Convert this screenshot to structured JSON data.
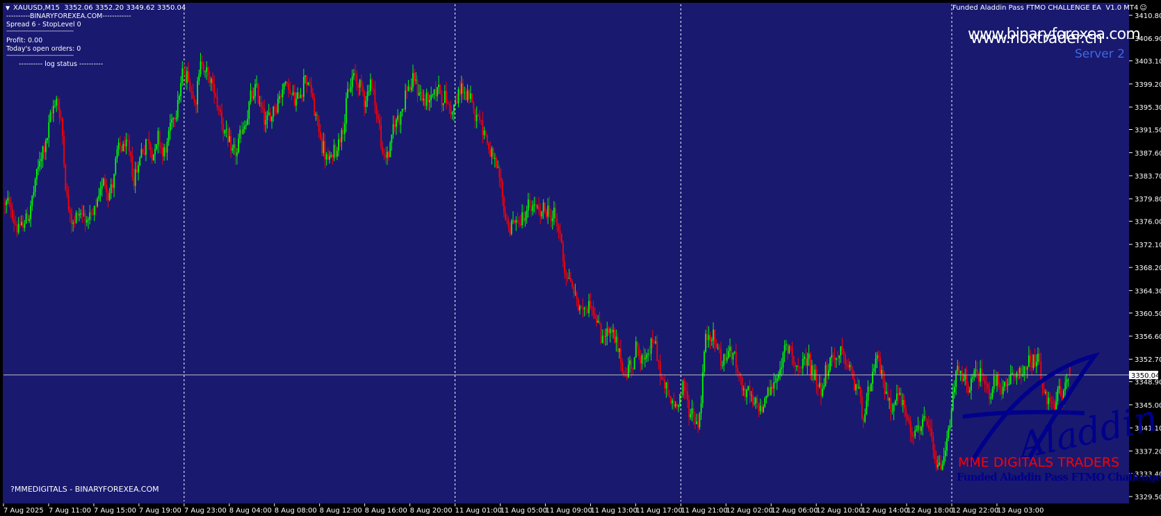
{
  "header": {
    "symbol_info": "XAUUSD,M15  3352.06 3352.20 3349.62 3350.04",
    "ea_title": "Funded Aladdin Pass FTMO CHALLENGE EA  V1.0 MT4"
  },
  "info_panel": {
    "line1": "----------BINARYFOREXEA.COM------------",
    "line2": "Spread 6 - StopLevel 0",
    "line3": "---------------------------------------------------------------",
    "line4": "Profit: 0.00",
    "line5": "Today's open orders: 0",
    "line6": "---------------------------------------------------------------",
    "line7": "---------- log status ----------"
  },
  "watermarks": {
    "site1": "www.binaryforexea.com",
    "site2": "www.noxtrader.cn",
    "server": "Server 2",
    "brand": "MME DIGITALS TRADERS",
    "product": "Funded Aladdin Pass FTMO Challenge EA",
    "logo_word": "Aladdin",
    "footer": "?MMEDIGITALS - BINARYFOREXEA.COM"
  },
  "price_marker": "3350.04",
  "colors": {
    "background": "#191970",
    "bull": "#00ff00",
    "bear": "#ff0000",
    "grid": "#ffffff",
    "axis_bg": "#000000",
    "server_text": "#4169e1",
    "brand_text": "#ff0000",
    "logo": "#00008b"
  },
  "chart_data": {
    "type": "candlestick",
    "symbol": "XAUUSD",
    "timeframe": "M15",
    "y_ticks": [
      "3410.80",
      "3406.90",
      "3403.10",
      "3399.20",
      "3395.30",
      "3391.50",
      "3387.60",
      "3383.70",
      "3379.80",
      "3376.00",
      "3372.10",
      "3368.20",
      "3364.30",
      "3360.50",
      "3356.60",
      "3352.70",
      "3348.90",
      "3345.00",
      "3341.10",
      "3337.20",
      "3333.40",
      "3329.50"
    ],
    "ylim": [
      3329.0,
      3411.5
    ],
    "x_ticks": [
      "7 Aug 2025",
      "7 Aug 11:00",
      "7 Aug 15:00",
      "7 Aug 19:00",
      "7 Aug 23:00",
      "8 Aug 04:00",
      "8 Aug 08:00",
      "8 Aug 12:00",
      "8 Aug 16:00",
      "8 Aug 20:00",
      "11 Aug 01:00",
      "11 Aug 05:00",
      "11 Aug 09:00",
      "11 Aug 13:00",
      "11 Aug 17:00",
      "11 Aug 21:00",
      "12 Aug 02:00",
      "12 Aug 06:00",
      "12 Aug 10:00",
      "12 Aug 14:00",
      "12 Aug 18:00",
      "12 Aug 22:00",
      "13 Aug 03:00"
    ],
    "session_separators": [
      "7 Aug 23:00",
      "11 Aug 01:00",
      "11 Aug 21:00",
      "12 Aug 22:00"
    ],
    "current_price": 3350.04,
    "last_bar": {
      "open": 3352.06,
      "high": 3352.2,
      "low": 3349.62,
      "close": 3350.04
    },
    "anchor_prices": [
      [
        0,
        3379
      ],
      [
        4,
        3378
      ],
      [
        8,
        3376
      ],
      [
        11,
        3374
      ],
      [
        15,
        3377
      ],
      [
        18,
        3379
      ],
      [
        22,
        3384
      ],
      [
        26,
        3389
      ],
      [
        29,
        3391
      ],
      [
        32,
        3395
      ],
      [
        35,
        3397
      ],
      [
        38,
        3392
      ],
      [
        42,
        3378
      ],
      [
        46,
        3376
      ],
      [
        50,
        3378
      ],
      [
        54,
        3377
      ],
      [
        58,
        3375
      ],
      [
        62,
        3379
      ],
      [
        66,
        3384
      ],
      [
        70,
        3381
      ],
      [
        74,
        3386
      ],
      [
        78,
        3389
      ],
      [
        82,
        3387
      ],
      [
        86,
        3383
      ],
      [
        90,
        3388
      ],
      [
        94,
        3390
      ],
      [
        98,
        3388
      ],
      [
        102,
        3390
      ],
      [
        106,
        3387
      ],
      [
        110,
        3392
      ],
      [
        114,
        3397
      ],
      [
        118,
        3401
      ],
      [
        122,
        3400
      ],
      [
        126,
        3397
      ],
      [
        130,
        3404
      ],
      [
        134,
        3400
      ],
      [
        138,
        3398
      ],
      [
        142,
        3395
      ],
      [
        146,
        3391
      ],
      [
        150,
        3386
      ],
      [
        154,
        3388
      ],
      [
        158,
        3392
      ],
      [
        162,
        3396
      ],
      [
        166,
        3398
      ],
      [
        170,
        3395
      ],
      [
        174,
        3392
      ],
      [
        178,
        3396
      ],
      [
        182,
        3398
      ],
      [
        186,
        3400
      ],
      [
        190,
        3397
      ],
      [
        194,
        3396
      ],
      [
        198,
        3402
      ],
      [
        202,
        3398
      ],
      [
        206,
        3392
      ],
      [
        210,
        3389
      ],
      [
        214,
        3385
      ],
      [
        218,
        3388
      ],
      [
        222,
        3392
      ],
      [
        226,
        3396
      ],
      [
        230,
        3401
      ],
      [
        234,
        3399
      ],
      [
        238,
        3397
      ],
      [
        242,
        3400
      ],
      [
        246,
        3394
      ],
      [
        250,
        3386
      ],
      [
        254,
        3388
      ],
      [
        258,
        3393
      ],
      [
        262,
        3395
      ],
      [
        266,
        3399
      ],
      [
        270,
        3399
      ],
      [
        274,
        3398
      ],
      [
        278,
        3396
      ],
      [
        282,
        3397
      ],
      [
        286,
        3399
      ],
      [
        290,
        3397
      ],
      [
        294,
        3395
      ],
      [
        298,
        3396
      ],
      [
        302,
        3399
      ],
      [
        306,
        3396
      ],
      [
        310,
        3395
      ],
      [
        314,
        3394
      ],
      [
        318,
        3390
      ],
      [
        322,
        3386
      ],
      [
        326,
        3382
      ],
      [
        330,
        3377
      ],
      [
        334,
        3375
      ],
      [
        338,
        3376
      ],
      [
        342,
        3377
      ],
      [
        346,
        3378
      ],
      [
        350,
        3378
      ],
      [
        354,
        3377
      ],
      [
        358,
        3378
      ],
      [
        362,
        3377
      ],
      [
        366,
        3374
      ],
      [
        370,
        3368
      ],
      [
        374,
        3365
      ],
      [
        378,
        3362
      ],
      [
        382,
        3360
      ],
      [
        386,
        3364
      ],
      [
        390,
        3360
      ],
      [
        394,
        3356
      ],
      [
        398,
        3358
      ],
      [
        402,
        3356
      ],
      [
        406,
        3352
      ],
      [
        410,
        3350
      ],
      [
        414,
        3353
      ],
      [
        418,
        3355
      ],
      [
        422,
        3351
      ],
      [
        426,
        3356
      ],
      [
        430,
        3354
      ],
      [
        434,
        3348
      ],
      [
        438,
        3346
      ],
      [
        442,
        3344
      ],
      [
        446,
        3348
      ],
      [
        450,
        3346
      ],
      [
        454,
        3343
      ],
      [
        458,
        3341
      ],
      [
        462,
        3356
      ],
      [
        466,
        3357
      ],
      [
        470,
        3355
      ],
      [
        474,
        3352
      ],
      [
        478,
        3354
      ],
      [
        482,
        3352
      ],
      [
        486,
        3349
      ],
      [
        490,
        3346
      ],
      [
        494,
        3344
      ],
      [
        498,
        3344
      ],
      [
        502,
        3347
      ],
      [
        506,
        3348
      ],
      [
        510,
        3350
      ],
      [
        514,
        3353
      ],
      [
        518,
        3355
      ],
      [
        522,
        3352
      ],
      [
        526,
        3350
      ],
      [
        530,
        3353
      ],
      [
        534,
        3350
      ],
      [
        538,
        3348
      ],
      [
        542,
        3351
      ],
      [
        546,
        3352
      ],
      [
        550,
        3354
      ],
      [
        554,
        3352
      ],
      [
        558,
        3350
      ],
      [
        562,
        3348
      ],
      [
        566,
        3344
      ],
      [
        570,
        3346
      ],
      [
        574,
        3352
      ],
      [
        578,
        3350
      ],
      [
        582,
        3347
      ],
      [
        586,
        3345
      ],
      [
        590,
        3347
      ],
      [
        594,
        3343
      ],
      [
        598,
        3341
      ],
      [
        602,
        3340
      ],
      [
        606,
        3342
      ],
      [
        610,
        3340
      ],
      [
        614,
        3334
      ],
      [
        618,
        3334
      ],
      [
        622,
        3340
      ],
      [
        626,
        3350
      ],
      [
        630,
        3349
      ],
      [
        634,
        3348
      ],
      [
        638,
        3349
      ],
      [
        642,
        3350
      ],
      [
        646,
        3349
      ],
      [
        650,
        3348
      ],
      [
        654,
        3348
      ],
      [
        658,
        3347
      ],
      [
        662,
        3348
      ],
      [
        666,
        3350
      ],
      [
        670,
        3352
      ],
      [
        674,
        3351
      ],
      [
        678,
        3352
      ],
      [
        682,
        3351
      ],
      [
        686,
        3346
      ],
      [
        690,
        3344
      ],
      [
        694,
        3346
      ],
      [
        698,
        3347
      ],
      [
        702,
        3350
      ]
    ],
    "anchor_note": "",
    "bar_count": 703
  }
}
